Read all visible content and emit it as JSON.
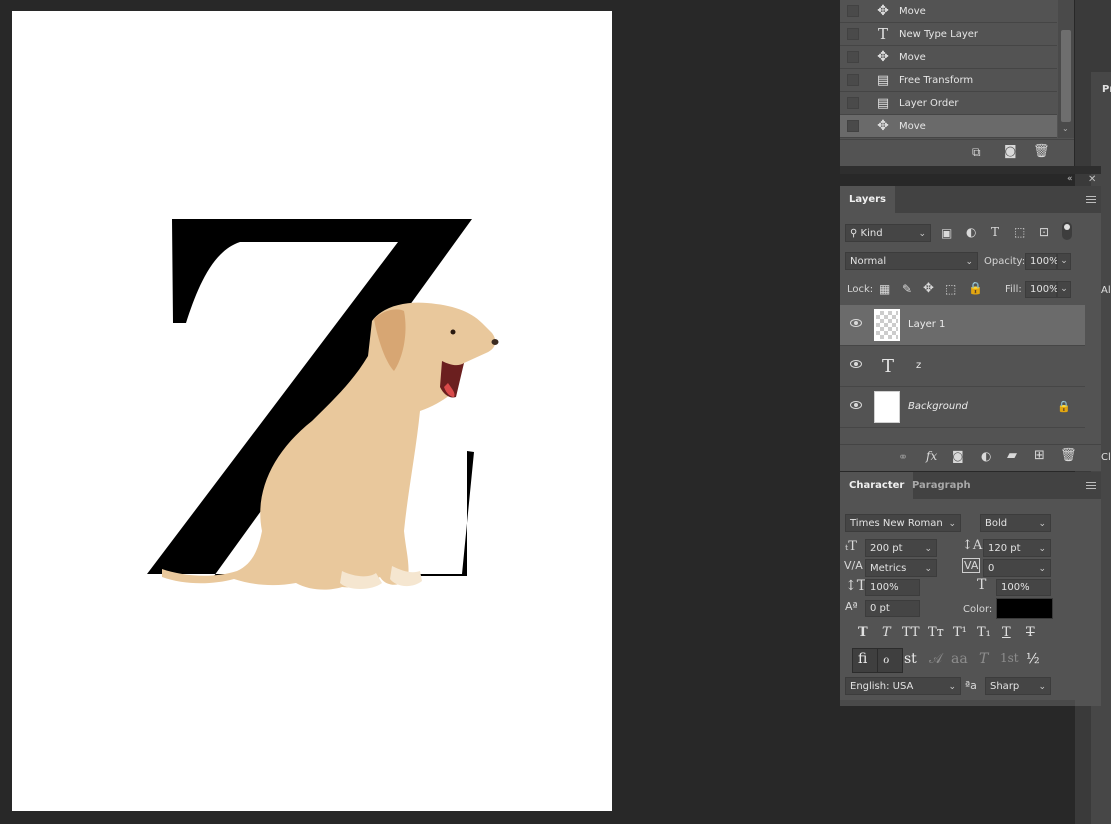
{
  "history": {
    "items": [
      {
        "label": "Move",
        "icon": "move-icon"
      },
      {
        "label": "New Type Layer",
        "icon": "type-tool-icon"
      },
      {
        "label": "Move",
        "icon": "move-icon"
      },
      {
        "label": "Free Transform",
        "icon": "history-doc-icon"
      },
      {
        "label": "Layer Order",
        "icon": "history-doc-icon"
      },
      {
        "label": "Move",
        "icon": "move-icon"
      }
    ],
    "active_index": 5
  },
  "canvas": {
    "letter": "Z"
  },
  "layers_panel": {
    "tab_label": "Layers",
    "filter_label": "Kind",
    "blend_mode": "Normal",
    "opacity_label": "Opacity:",
    "opacity_value": "100%",
    "lock_label": "Lock:",
    "fill_label": "Fill:",
    "fill_value": "100%",
    "layers": [
      {
        "name": "Layer 1",
        "type": "pixel",
        "selected": true
      },
      {
        "name": "z",
        "type": "type",
        "selected": false
      },
      {
        "name": "Background",
        "type": "background",
        "selected": false,
        "locked": true
      }
    ]
  },
  "character_panel": {
    "tabs": [
      "Character",
      "Paragraph"
    ],
    "font_family": "Times New Roman",
    "font_style": "Bold",
    "font_size": "200 pt",
    "leading": "120 pt",
    "kerning": "Metrics",
    "tracking": "0",
    "vertical_scale": "100%",
    "horizontal_scale": "100%",
    "baseline_shift": "0 pt",
    "color_label": "Color:",
    "color_value": "#000000",
    "text_styles": [
      "T",
      "T",
      "TT",
      "Tт",
      "T¹",
      "T₁",
      "T",
      "T"
    ],
    "opentype": [
      "fi",
      "ℴ",
      "st",
      "𝒜",
      "aa",
      "T",
      "1st",
      "½"
    ],
    "language": "English: USA",
    "aa_glyph": "ªa",
    "antialias": "Sharp"
  },
  "right_strip": {
    "partial_label_1": "Pr",
    "partial_label_2": "Al",
    "partial_label_3": "Cl"
  }
}
